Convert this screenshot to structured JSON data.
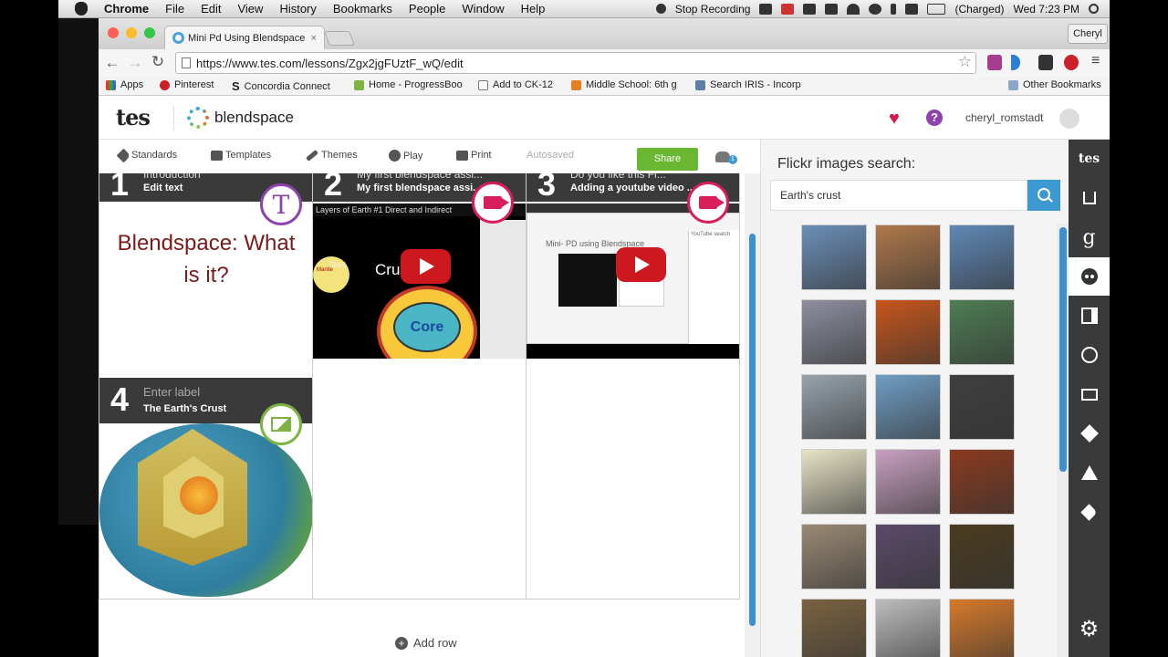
{
  "menubar": {
    "app": "Chrome",
    "items": [
      "File",
      "Edit",
      "View",
      "History",
      "Bookmarks",
      "People",
      "Window",
      "Help"
    ],
    "status": {
      "stop_recording": "Stop Recording",
      "battery": "(Charged)",
      "clock": "Wed 7:23 PM"
    }
  },
  "browser": {
    "tab_title": "Mini Pd Using Blendspace",
    "tab_close": "×",
    "profile": "Cheryl",
    "url": "https://www.tes.com/lessons/Zgx2jgFUztF_wQ/edit",
    "bookmarks": [
      "Apps",
      "Pinterest",
      "Concordia Connect",
      "Home - ProgressBoo",
      "Add to CK-12",
      "Middle School: 6th g",
      "Search IRIS - Incorp"
    ],
    "other_bookmarks": "Other Bookmarks",
    "colors": {
      "pinterest": "#cb2027",
      "progressbook": "#7cb342",
      "middle": "#e67e22",
      "iris": "#5c7fa3"
    }
  },
  "app": {
    "tes_logo": "tes",
    "blendspace_logo": "blendspace",
    "username": "cheryl_romstadt",
    "help": "?"
  },
  "toolbar": {
    "standards": "Standards",
    "templates": "Templates",
    "themes": "Themes",
    "play": "Play",
    "print": "Print",
    "autosaved": "Autosaved",
    "share": "Share",
    "collab_count": "1"
  },
  "tiles": [
    {
      "num": "1",
      "label": "Introduction",
      "sub": "Edit text",
      "body": "Blendspace:  What is it?",
      "badge": "T"
    },
    {
      "num": "2",
      "label": "My first blendspace assi...",
      "sub": "My first blendspace assi...",
      "video_caption": "Layers of Earth #1 Direct and Indirect",
      "core": "Core",
      "crust": "Crus",
      "mantle": "Mantle"
    },
    {
      "num": "3",
      "label": "Do you like this Fl...",
      "sub": "Adding a youtube video ...",
      "screen_title": "Mini- PD using Blendspace",
      "screen_search": "YouTube search"
    },
    {
      "num": "4",
      "label": "Enter label",
      "sub": "The Earth's Crust"
    }
  ],
  "add_row": "Add row",
  "panel": {
    "title": "Flickr images search:",
    "query": "Earth's crust",
    "thumbs": [
      "#6b8fb8",
      "#b0784a",
      "#5f88b6",
      "#8e8ea0",
      "#c8551b",
      "#4d7d52",
      "#97a3ad",
      "#6f9ec4",
      "#3f3f3f",
      "#e9e4c6",
      "#c9a0c0",
      "#8a3a1e",
      "#9a8a74",
      "#5b4a6a",
      "#4a3b1e",
      "#7a6240",
      "#bdbdbd",
      "#d87a2a"
    ]
  },
  "rail": [
    "tes-icon",
    "upload-icon",
    "google-icon",
    "flickr-icon",
    "split-icon",
    "globe-icon",
    "monitor-icon",
    "dropbox-icon",
    "drive-icon",
    "tag-icon",
    "settings-icon"
  ],
  "rail_tes": "tes",
  "rail_google": "g"
}
